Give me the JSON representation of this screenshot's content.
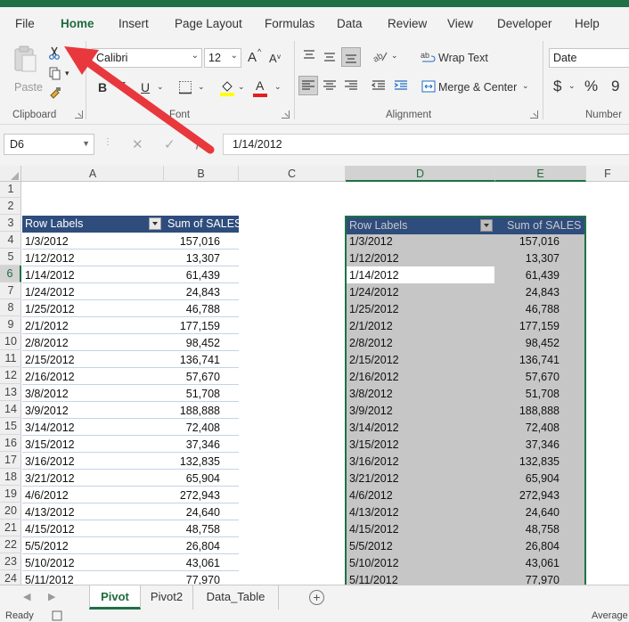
{
  "menu": [
    "File",
    "Home",
    "Insert",
    "Page Layout",
    "Formulas",
    "Data",
    "Review",
    "View",
    "Developer",
    "Help"
  ],
  "ribbon": {
    "clipboard": {
      "paste_label": "Paste",
      "group_label": "Clipboard"
    },
    "font": {
      "name": "Calibri",
      "size": "12",
      "bold": "B",
      "italic": "I",
      "underline": "U",
      "grow": "A",
      "shrink": "A",
      "font_color_glyph": "A",
      "group_label": "Font"
    },
    "alignment": {
      "wrap_text": "Wrap Text",
      "merge_center": "Merge & Center",
      "group_label": "Alignment"
    },
    "number": {
      "format": "Date",
      "currency": "$",
      "percent": "%",
      "comma": "9",
      "group_label": "Number"
    }
  },
  "formula_bar": {
    "name_box": "D6",
    "cancel": "✕",
    "enter": "✓",
    "fx": "fx",
    "value": "1/14/2012"
  },
  "columns": [
    "A",
    "B",
    "C",
    "D",
    "E",
    "F"
  ],
  "rows": [
    "1",
    "2",
    "3",
    "4",
    "5",
    "6",
    "7",
    "8",
    "9",
    "10",
    "11",
    "12",
    "13",
    "14",
    "15",
    "16",
    "17",
    "18",
    "19",
    "20",
    "21",
    "22",
    "23",
    "24"
  ],
  "selection": {
    "active_cell": "D6",
    "selected_columns": [
      "D",
      "E"
    ]
  },
  "pivot_headers": {
    "row_labels": "Row Labels",
    "sum_sales": "Sum of SALES"
  },
  "pivot_rows": [
    {
      "date": "1/3/2012",
      "sales": "157,016"
    },
    {
      "date": "1/12/2012",
      "sales": "13,307"
    },
    {
      "date": "1/14/2012",
      "sales": "61,439"
    },
    {
      "date": "1/24/2012",
      "sales": "24,843"
    },
    {
      "date": "1/25/2012",
      "sales": "46,788"
    },
    {
      "date": "2/1/2012",
      "sales": "177,159"
    },
    {
      "date": "2/8/2012",
      "sales": "98,452"
    },
    {
      "date": "2/15/2012",
      "sales": "136,741"
    },
    {
      "date": "2/16/2012",
      "sales": "57,670"
    },
    {
      "date": "3/8/2012",
      "sales": "51,708"
    },
    {
      "date": "3/9/2012",
      "sales": "188,888"
    },
    {
      "date": "3/14/2012",
      "sales": "72,408"
    },
    {
      "date": "3/15/2012",
      "sales": "37,346"
    },
    {
      "date": "3/16/2012",
      "sales": "132,835"
    },
    {
      "date": "3/21/2012",
      "sales": "65,904"
    },
    {
      "date": "4/6/2012",
      "sales": "272,943"
    },
    {
      "date": "4/13/2012",
      "sales": "24,640"
    },
    {
      "date": "4/15/2012",
      "sales": "48,758"
    },
    {
      "date": "5/5/2012",
      "sales": "26,804"
    },
    {
      "date": "5/10/2012",
      "sales": "43,061"
    },
    {
      "date": "5/11/2012",
      "sales": "77,970"
    }
  ],
  "sheet_tabs": [
    "Pivot",
    "Pivot2",
    "Data_Table"
  ],
  "status": {
    "ready": "Ready",
    "average": "Average"
  },
  "colors": {
    "excel_green": "#1f7145",
    "pivot_header": "#2e4d7d",
    "annotation_arrow": "#e8383d"
  }
}
